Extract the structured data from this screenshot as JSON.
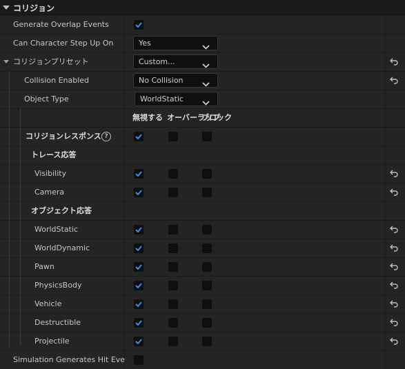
{
  "section_title": "コリジョン",
  "generate_overlap_events": {
    "label": "Generate Overlap Events",
    "checked": true
  },
  "can_character_step_up_on": {
    "label": "Can Character Step Up On",
    "value": "Yes"
  },
  "collision_presets": {
    "label": "コリジョンプリセット",
    "value": "Custom..."
  },
  "collision_enabled": {
    "label": "Collision Enabled",
    "value": "No Collision"
  },
  "object_type": {
    "label": "Object Type",
    "value": "WorldStatic"
  },
  "response_headers": {
    "ignore": "無視する",
    "overlap": "オーバーラップ",
    "block": "ブロック"
  },
  "collision_responses": {
    "label": "コリジョンレスポンス",
    "help": "?",
    "state": "ignore"
  },
  "trace_responses": {
    "label": "トレース応答",
    "items": [
      {
        "label": "Visibility",
        "state": "ignore"
      },
      {
        "label": "Camera",
        "state": "ignore"
      }
    ]
  },
  "object_responses": {
    "label": "オブジェクト応答",
    "items": [
      {
        "label": "WorldStatic",
        "state": "ignore"
      },
      {
        "label": "WorldDynamic",
        "state": "ignore"
      },
      {
        "label": "Pawn",
        "state": "ignore"
      },
      {
        "label": "PhysicsBody",
        "state": "ignore"
      },
      {
        "label": "Vehicle",
        "state": "ignore"
      },
      {
        "label": "Destructible",
        "state": "ignore"
      },
      {
        "label": "Projectile",
        "state": "ignore"
      }
    ]
  },
  "simulation_generates_hit_events": {
    "label": "Simulation Generates Hit Eve",
    "checked": false
  },
  "colors": {
    "check": "#3d8ee8",
    "panel": "#242424",
    "section": "#1a1a1a",
    "field": "#0f0f0f"
  },
  "icons": {
    "reset": "reset-arrow-icon",
    "dropdown": "chevron-down-icon",
    "collapse": "triangle-down-icon",
    "help": "help-circle-icon"
  }
}
